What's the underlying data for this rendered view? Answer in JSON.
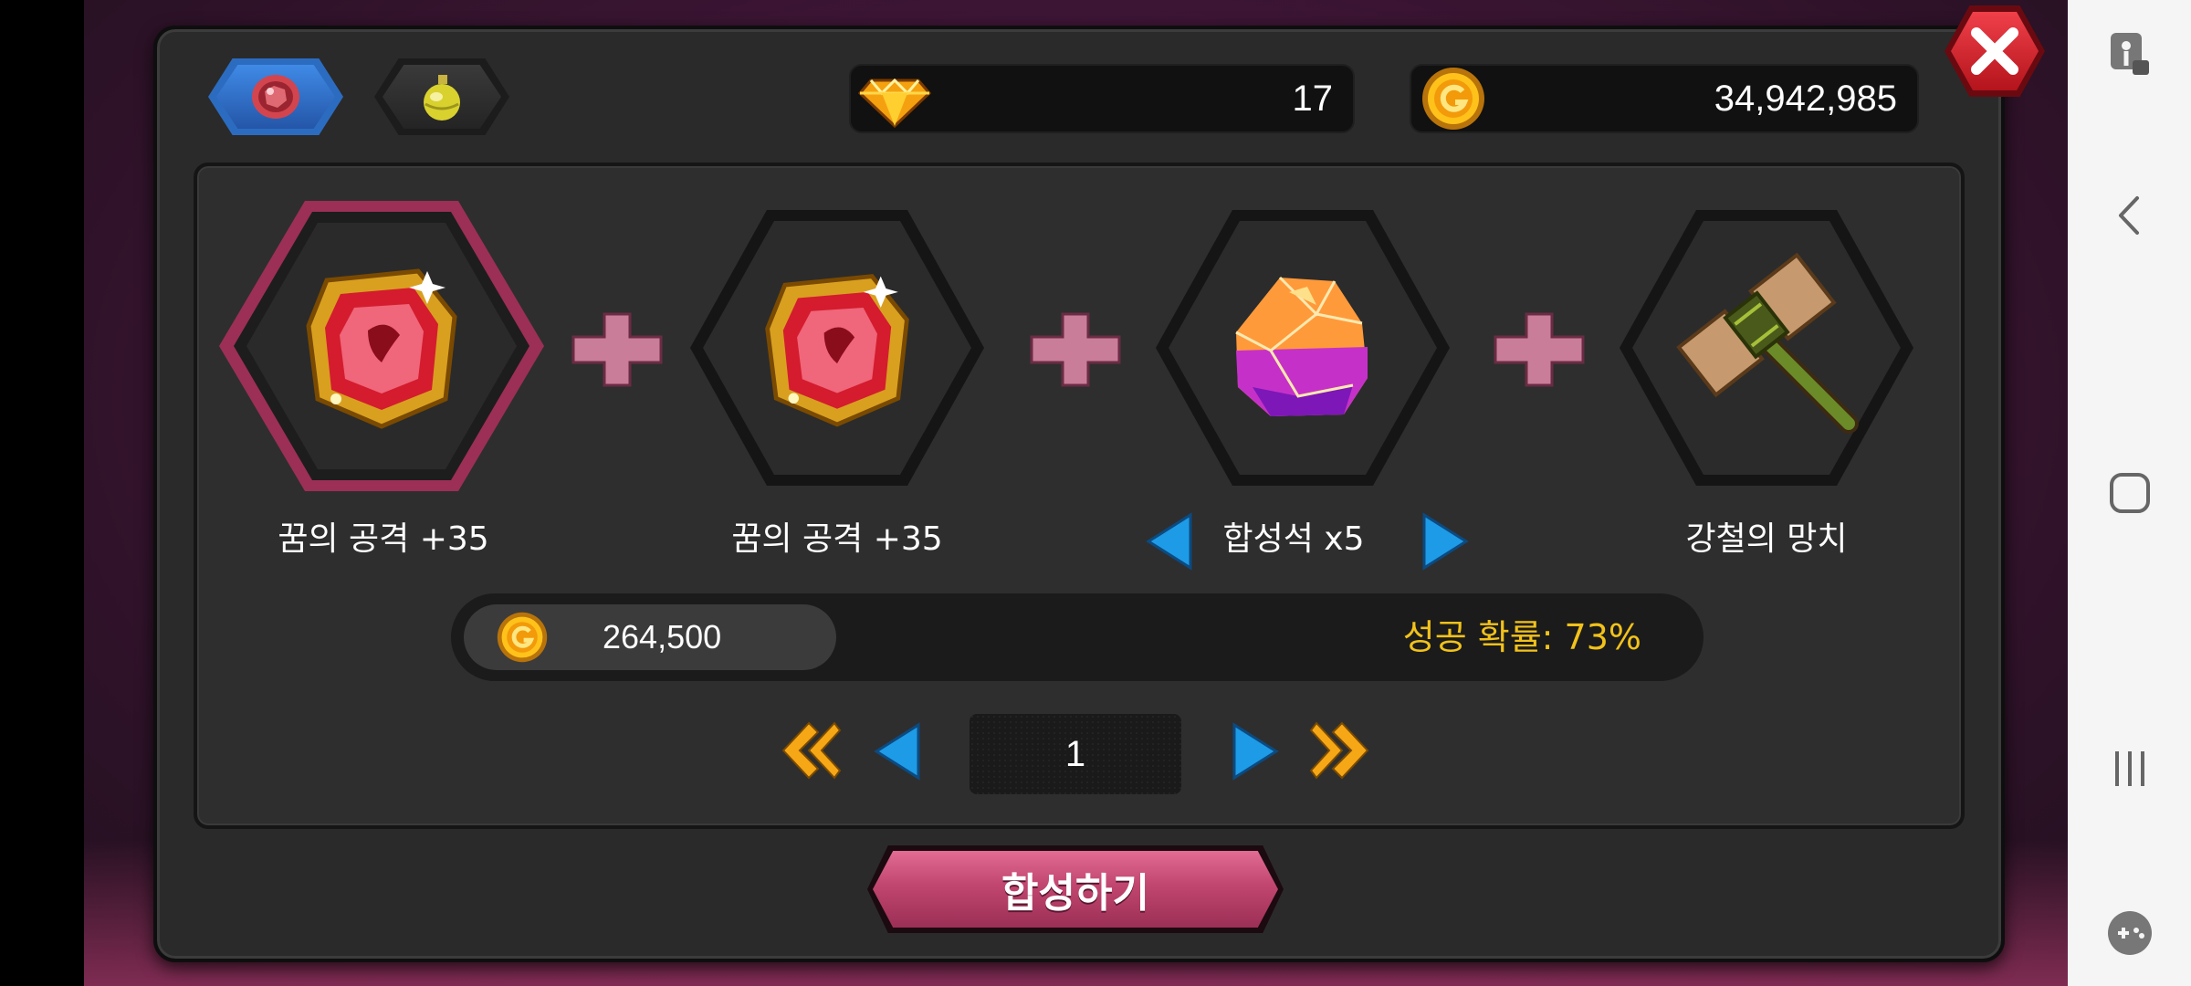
{
  "tabs": [
    {
      "icon": "red-gem-icon",
      "active": true
    },
    {
      "icon": "yellow-potion-icon",
      "active": false
    }
  ],
  "currency": {
    "diamonds": "17",
    "gold": "34,942,985"
  },
  "recipe": {
    "slots": [
      {
        "name": "꿈의 공격 +35",
        "icon": "red-ruby-gem-icon",
        "selected": true
      },
      {
        "name": "꿈의 공격 +35",
        "icon": "red-ruby-gem-icon",
        "selected": false
      },
      {
        "name": "합성석 x5",
        "icon": "synthesis-stone-icon",
        "selected": false
      },
      {
        "name": "강철의 망치",
        "icon": "steel-hammer-icon",
        "selected": false
      }
    ]
  },
  "cost": "264,500",
  "success_rate": "성공 확률: 73%",
  "pagination": {
    "page": "1"
  },
  "merge_button": "합성하기",
  "colors": {
    "accent_gold": "#f2c21a",
    "merge_pink": "#c1466f",
    "tab_blue": "#2c6cc0",
    "arrow_blue": "#1e9be6"
  }
}
